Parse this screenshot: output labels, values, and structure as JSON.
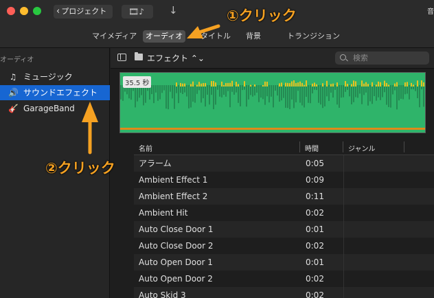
{
  "titlebar": {
    "back_label": "プロジェクト",
    "right_edge_char": "音"
  },
  "tabs": [
    {
      "label": "マイメディア",
      "active": false
    },
    {
      "label": "オーディオ",
      "active": true
    },
    {
      "label": "タイトル",
      "active": false
    },
    {
      "label": "背景",
      "active": false
    },
    {
      "label": "トランジション",
      "active": false
    }
  ],
  "sidebar": {
    "header": "オーディオ",
    "items": [
      {
        "label": "ミュージック",
        "icon": "music-note-icon",
        "selected": false
      },
      {
        "label": "サウンドエフェクト",
        "icon": "speaker-icon",
        "selected": true
      },
      {
        "label": "GarageBand",
        "icon": "guitar-icon",
        "selected": false
      }
    ]
  },
  "toolbar": {
    "category": "エフェクト",
    "search_placeholder": "検索"
  },
  "waveform": {
    "duration": "35.5 秒"
  },
  "table": {
    "headers": {
      "name": "名前",
      "time": "時間",
      "genre": "ジャンル"
    },
    "rows": [
      {
        "name": "アラーム",
        "time": "0:05"
      },
      {
        "name": "Ambient Effect 1",
        "time": "0:09"
      },
      {
        "name": "Ambient Effect 2",
        "time": "0:11"
      },
      {
        "name": "Ambient Hit",
        "time": "0:02"
      },
      {
        "name": "Auto Close Door 1",
        "time": "0:01"
      },
      {
        "name": "Auto Close Door 2",
        "time": "0:02"
      },
      {
        "name": "Auto Open Door 1",
        "time": "0:01"
      },
      {
        "name": "Auto Open Door 2",
        "time": "0:02"
      },
      {
        "name": "Auto Skid 3",
        "time": "0:02"
      }
    ]
  },
  "annotations": {
    "step1": "①クリック",
    "step2": "②クリック"
  },
  "colors": {
    "accent": "#1766d2",
    "annotation": "#f5a122",
    "waveform": "#2fb46a"
  }
}
